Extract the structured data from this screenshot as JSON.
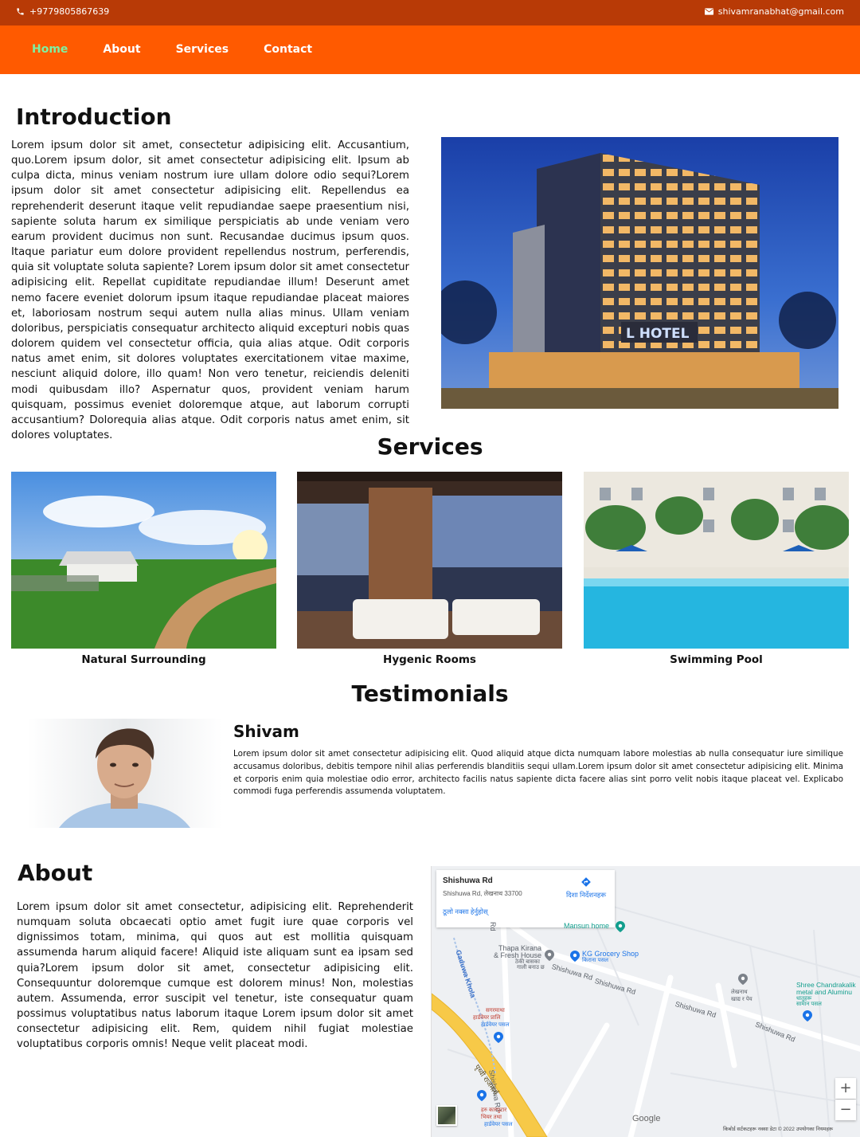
{
  "topbar": {
    "phone": "+9779805867639",
    "email": "shivamranabhat@gmail.com"
  },
  "nav": {
    "items": [
      {
        "label": "Home",
        "active": true
      },
      {
        "label": "About"
      },
      {
        "label": "Services"
      },
      {
        "label": "Contact"
      }
    ],
    "accent_color": "#ff5a00",
    "active_color": "#7ff0a0"
  },
  "intro": {
    "title": "Introduction",
    "text": "Lorem ipsum dolor sit amet, consectetur adipisicing elit. Accusantium, quo.Lorem ipsum dolor, sit amet consectetur adipisicing elit. Ipsum ab culpa dicta, minus veniam nostrum iure ullam dolore odio sequi?Lorem ipsum dolor sit amet consectetur adipisicing elit. Repellendus ea reprehenderit deserunt itaque velit repudiandae saepe praesentium nisi, sapiente soluta harum ex similique perspiciatis ab unde veniam vero earum provident ducimus non sunt. Recusandae ducimus ipsum quos. Itaque pariatur eum dolore provident repellendus nostrum, perferendis, quia sit voluptate soluta sapiente? Lorem ipsum dolor sit amet consectetur adipisicing elit. Repellat cupiditate repudiandae illum! Deserunt amet nemo facere eveniet dolorum ipsum itaque repudiandae placeat maiores et, laboriosam nostrum sequi autem nulla alias minus. Ullam veniam doloribus, perspiciatis consequatur architecto aliquid excepturi nobis quas dolorem quidem vel consectetur officia, quia alias atque. Odit corporis natus amet enim, sit dolores voluptates exercitationem vitae maxime, nesciunt aliquid dolore, illo quam! Non vero tenetur, reiciendis deleniti modi quibusdam illo? Aspernatur quos, provident veniam harum quisquam, possimus eveniet doloremque atque, aut laborum corrupti accusantium? Dolorequia alias atque. Odit corporis natus amet enim, sit dolores voluptates.",
    "hotel_sign": "L HOTEL"
  },
  "services": {
    "title": "Services",
    "items": [
      {
        "caption": "Natural Surrounding"
      },
      {
        "caption": "Hygenic Rooms"
      },
      {
        "caption": "Swimming Pool"
      }
    ]
  },
  "testimonials": {
    "title": "Testimonials",
    "name": "Shivam",
    "text": "Lorem ipsum dolor sit amet consectetur adipisicing elit. Quod aliquid atque dicta numquam labore molestias ab nulla consequatur iure similique accusamus doloribus, debitis tempore nihil alias perferendis blanditiis sequi ullam.Lorem ipsum dolor sit amet consectetur adipisicing elit. Minima et corporis enim quia molestiae odio error, architecto facilis natus sapiente dicta facere alias sint porro velit nobis itaque placeat vel. Explicabo commodi fuga perferendis assumenda voluptatem."
  },
  "about": {
    "title": "About",
    "text": "Lorem ipsum dolor sit amet consectetur, adipisicing elit. Reprehenderit numquam soluta obcaecati optio amet fugit iure quae corporis vel dignissimos totam, minima, qui quos aut est mollitia quisquam assumenda harum aliquid facere! Aliquid iste aliquam sunt ea ipsam sed quia?Lorem ipsum dolor sit amet, consectetur adipisicing elit. Consequuntur doloremque cumque est dolorem minus! Non, molestias autem. Assumenda, error suscipit vel tenetur, iste consequatur quam possimus voluptatibus natus laborum itaque Lorem ipsum dolor sit amet consectetur adipisicing elit. Rem, quidem nihil fugiat molestiae voluptatibus corporis omnis! Neque velit placeat modi."
  },
  "map": {
    "place_title": "Shishuwa Rd",
    "place_subtitle": "Shishuwa Rd, लेखनाथ 33700",
    "larger_map_link": "ठूलो नक्सा हेर्नुहोस्",
    "directions_label": "दिशा निर्देशनहरू",
    "labels": {
      "mansun_home": "Mansun home",
      "thapa_kirana": "Thapa Kirana",
      "fresh_house": "& Fresh House",
      "thapa_sub": "ठेकी बासका",
      "thapa_sub2": "गाली बनाउ छ",
      "kg_grocery": "KG Grocery Shop",
      "kg_sub": "किराना पसल",
      "shishuwa_rd_1": "Shishuwa Rd",
      "shishuwa_rd_2": "Shishuwa Rd",
      "shishuwa_rd_3": "Shishuwa Rd",
      "shishuwa_rd_4": "Shishuwa Rd",
      "shishuwa_rd_5": "Shishuwa Rd",
      "gaduwa_khola": "Gaduwa Khola",
      "hardware_1": "सगरमाथा",
      "hardware_2": "हार्डवेयर प्रालि",
      "hardware_3": "हार्डवेयर पसल",
      "lekhnath_1": "लेखनाथ",
      "lekhnath_2": "खाद्य र पेय",
      "shree_1": "Shree Chandrakalik",
      "shree_2": "metal and Aluminu",
      "shree_3": "धातुहरू",
      "shree_4": "सामान पसल",
      "prithvi": "पृथ्वी राजमार्ग",
      "bottom_1": "हरु कारपुटार",
      "bottom_2": "भियर तथा",
      "bottom_3": "हार्डवेयर पसल",
      "road_r": "Rd"
    },
    "zoom_in": "+",
    "zoom_out": "−",
    "google": "Google",
    "footer": "किबोर्ड सर्टकटहरू    नक्सा डेटा © 2022    उपयोगका नियमहरू"
  }
}
